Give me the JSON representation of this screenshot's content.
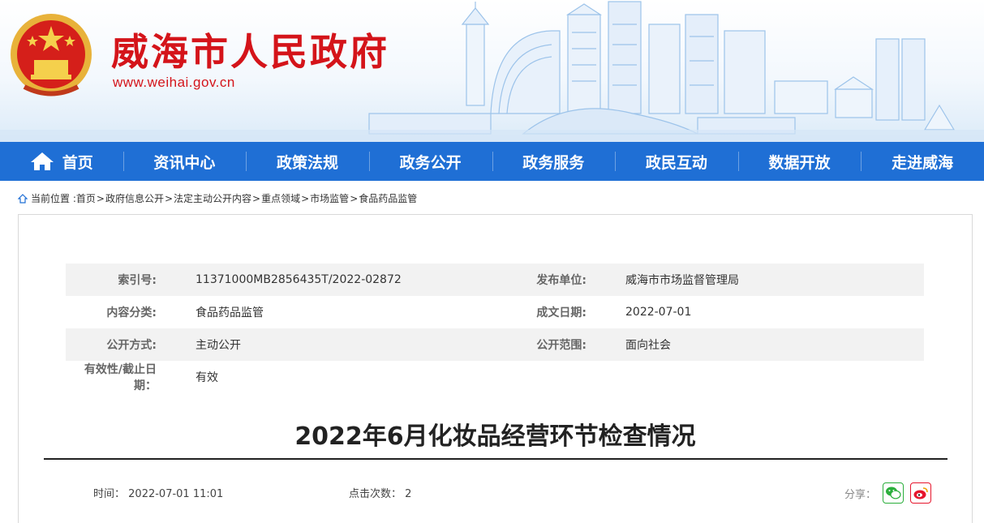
{
  "header": {
    "site_title": "威海市人民政府",
    "site_url": "www.weihai.gov.cn",
    "brand_color": "#d4141a"
  },
  "nav": {
    "color": "#1f6fd5",
    "items": [
      {
        "label": "首页",
        "icon": "home-icon"
      },
      {
        "label": "资讯中心"
      },
      {
        "label": "政策法规"
      },
      {
        "label": "政务公开"
      },
      {
        "label": "政务服务"
      },
      {
        "label": "政民互动"
      },
      {
        "label": "数据开放"
      },
      {
        "label": "走进威海"
      }
    ]
  },
  "breadcrumb": {
    "prefix": "当前位置 :",
    "items": [
      "首页",
      "政府信息公开",
      "法定主动公开内容",
      "重点领域",
      "市场监管",
      "食品药品监管"
    ],
    "separator": ">"
  },
  "meta": {
    "index_label": "索引号:",
    "index_value": "11371000MB2856435T/2022-02872",
    "publisher_label": "发布单位:",
    "publisher_value": "威海市市场监督管理局",
    "category_label": "内容分类:",
    "category_value": "食品药品监管",
    "date_label": "成文日期:",
    "date_value": "2022-07-01",
    "method_label": "公开方式:",
    "method_value": "主动公开",
    "scope_label": "公开范围:",
    "scope_value": "面向社会",
    "validity_label": "有效性/截止日期：",
    "validity_value": "有效"
  },
  "article": {
    "title": "2022年6月化妆品经营环节检查情况",
    "time_label": "时间：",
    "time_value": "2022-07-01 11:01",
    "clicks_label": "点击次数：",
    "clicks_value": "2",
    "share_label": "分享："
  }
}
